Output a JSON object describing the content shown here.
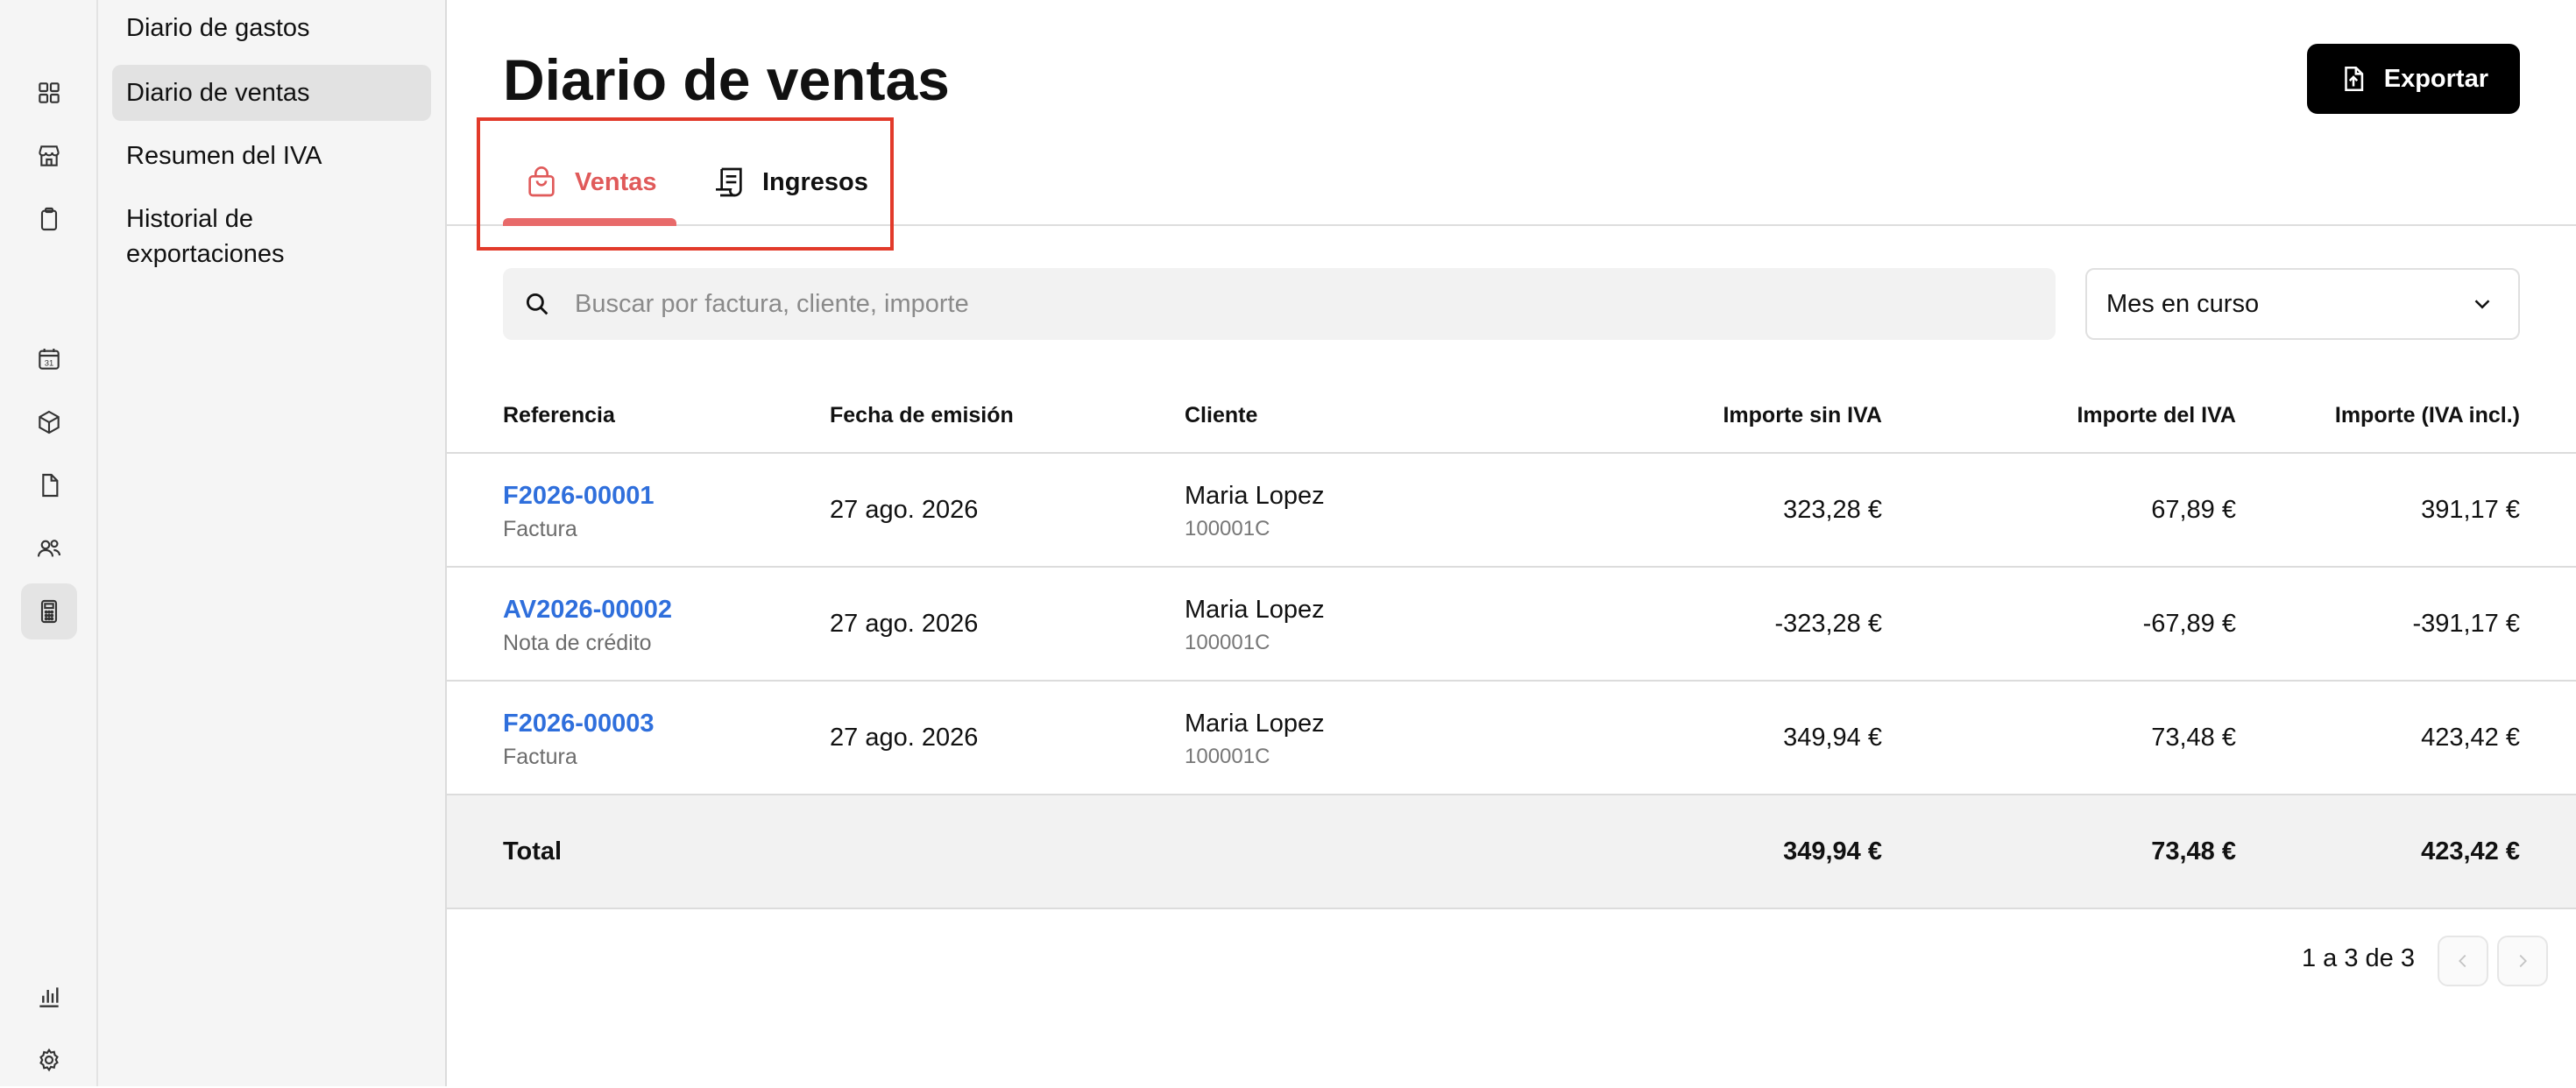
{
  "rail": {
    "top_icons": [
      "dashboard-icon",
      "store-icon",
      "clipboard-icon"
    ],
    "mid_icons": [
      "calendar-icon",
      "box-icon",
      "document-icon",
      "users-icon",
      "calculator-icon"
    ],
    "bottom_icons": [
      "bar-chart-icon",
      "gear-icon"
    ],
    "calendar_day": "31"
  },
  "sidebar": {
    "items": [
      {
        "label": "Diario de gastos"
      },
      {
        "label": "Diario de ventas"
      },
      {
        "label": "Resumen del IVA"
      },
      {
        "label": "Historial de exportaciones"
      }
    ],
    "active_index": 1
  },
  "header": {
    "title": "Diario de ventas",
    "export_label": "Exportar"
  },
  "tabs": [
    {
      "label": "Ventas",
      "icon": "shopping-bag-icon",
      "active": true
    },
    {
      "label": "Ingresos",
      "icon": "receipt-icon",
      "active": false
    }
  ],
  "search": {
    "placeholder": "Buscar por factura, cliente, importe",
    "value": ""
  },
  "period_select": {
    "value": "Mes en curso"
  },
  "table": {
    "headers": {
      "reference": "Referencia",
      "date": "Fecha de emisión",
      "client": "Cliente",
      "net": "Importe sin IVA",
      "vat": "Importe del IVA",
      "gross": "Importe (IVA incl.)"
    },
    "rows": [
      {
        "reference": "F2026-00001",
        "type": "Factura",
        "date": "27 ago. 2026",
        "client": "Maria Lopez",
        "client_code": "100001C",
        "net": "323,28 €",
        "vat": "67,89 €",
        "gross": "391,17 €"
      },
      {
        "reference": "AV2026-00002",
        "type": "Nota de crédito",
        "date": "27 ago. 2026",
        "client": "Maria Lopez",
        "client_code": "100001C",
        "net": "-323,28 €",
        "vat": "-67,89 €",
        "gross": "-391,17 €"
      },
      {
        "reference": "F2026-00003",
        "type": "Factura",
        "date": "27 ago. 2026",
        "client": "Maria Lopez",
        "client_code": "100001C",
        "net": "349,94 €",
        "vat": "73,48 €",
        "gross": "423,42 €"
      }
    ],
    "total": {
      "label": "Total",
      "net": "349,94 €",
      "vat": "73,48 €",
      "gross": "423,42 €"
    }
  },
  "pagination": {
    "text": "1 a 3 de 3"
  },
  "colors": {
    "accent": "#e05a5a",
    "link": "#2f6fdc",
    "highlight_box": "#e23a2a",
    "button_bg": "#000000"
  }
}
